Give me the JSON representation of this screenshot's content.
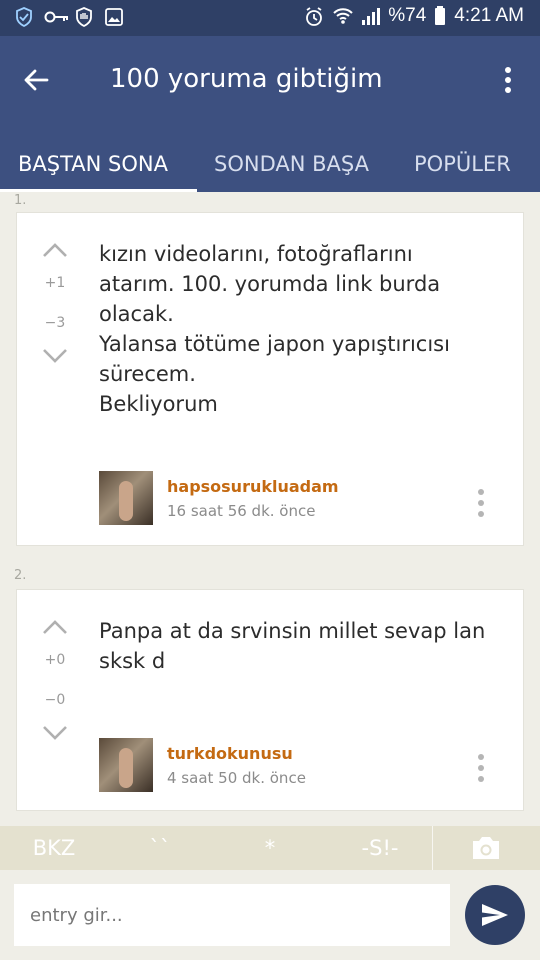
{
  "status_bar": {
    "battery": "%74",
    "time": "4:21 AM"
  },
  "app_bar": {
    "title": "100 yoruma gibtiğim"
  },
  "tabs": [
    {
      "label": "BAŞTAN SONA",
      "active": true
    },
    {
      "label": "SONDAN BAŞA",
      "active": false
    },
    {
      "label": "POPÜLER",
      "active": false
    }
  ],
  "entries": [
    {
      "number": "1.",
      "upvotes": "+1",
      "downvotes": "−3",
      "text": "kızın videolarını, fotoğraflarını\natarım. 100. yorumda link burda\nolacak.\nYalansa tötüme japon yapıştırıcısı\nsürecem.\nBekliyorum",
      "author": "hapsosurukluadam",
      "time": "16 saat 56 dk. önce"
    },
    {
      "number": "2.",
      "upvotes": "+0",
      "downvotes": "−0",
      "text": "Panpa at da srvinsin millet sevap lan\nsksk d",
      "author": "turkdokunusu",
      "time": "4 saat 50 dk. önce"
    }
  ],
  "toolbar": {
    "bkz": "BKZ",
    "backticks": "``",
    "star": "*",
    "spoiler": "-S!-"
  },
  "composer": {
    "placeholder": "entry gir..."
  },
  "colors": {
    "status_bar": "#2f4066",
    "app_bar": "#3d5080",
    "author": "#c46a12",
    "toolbar": "#e4e1cf"
  }
}
